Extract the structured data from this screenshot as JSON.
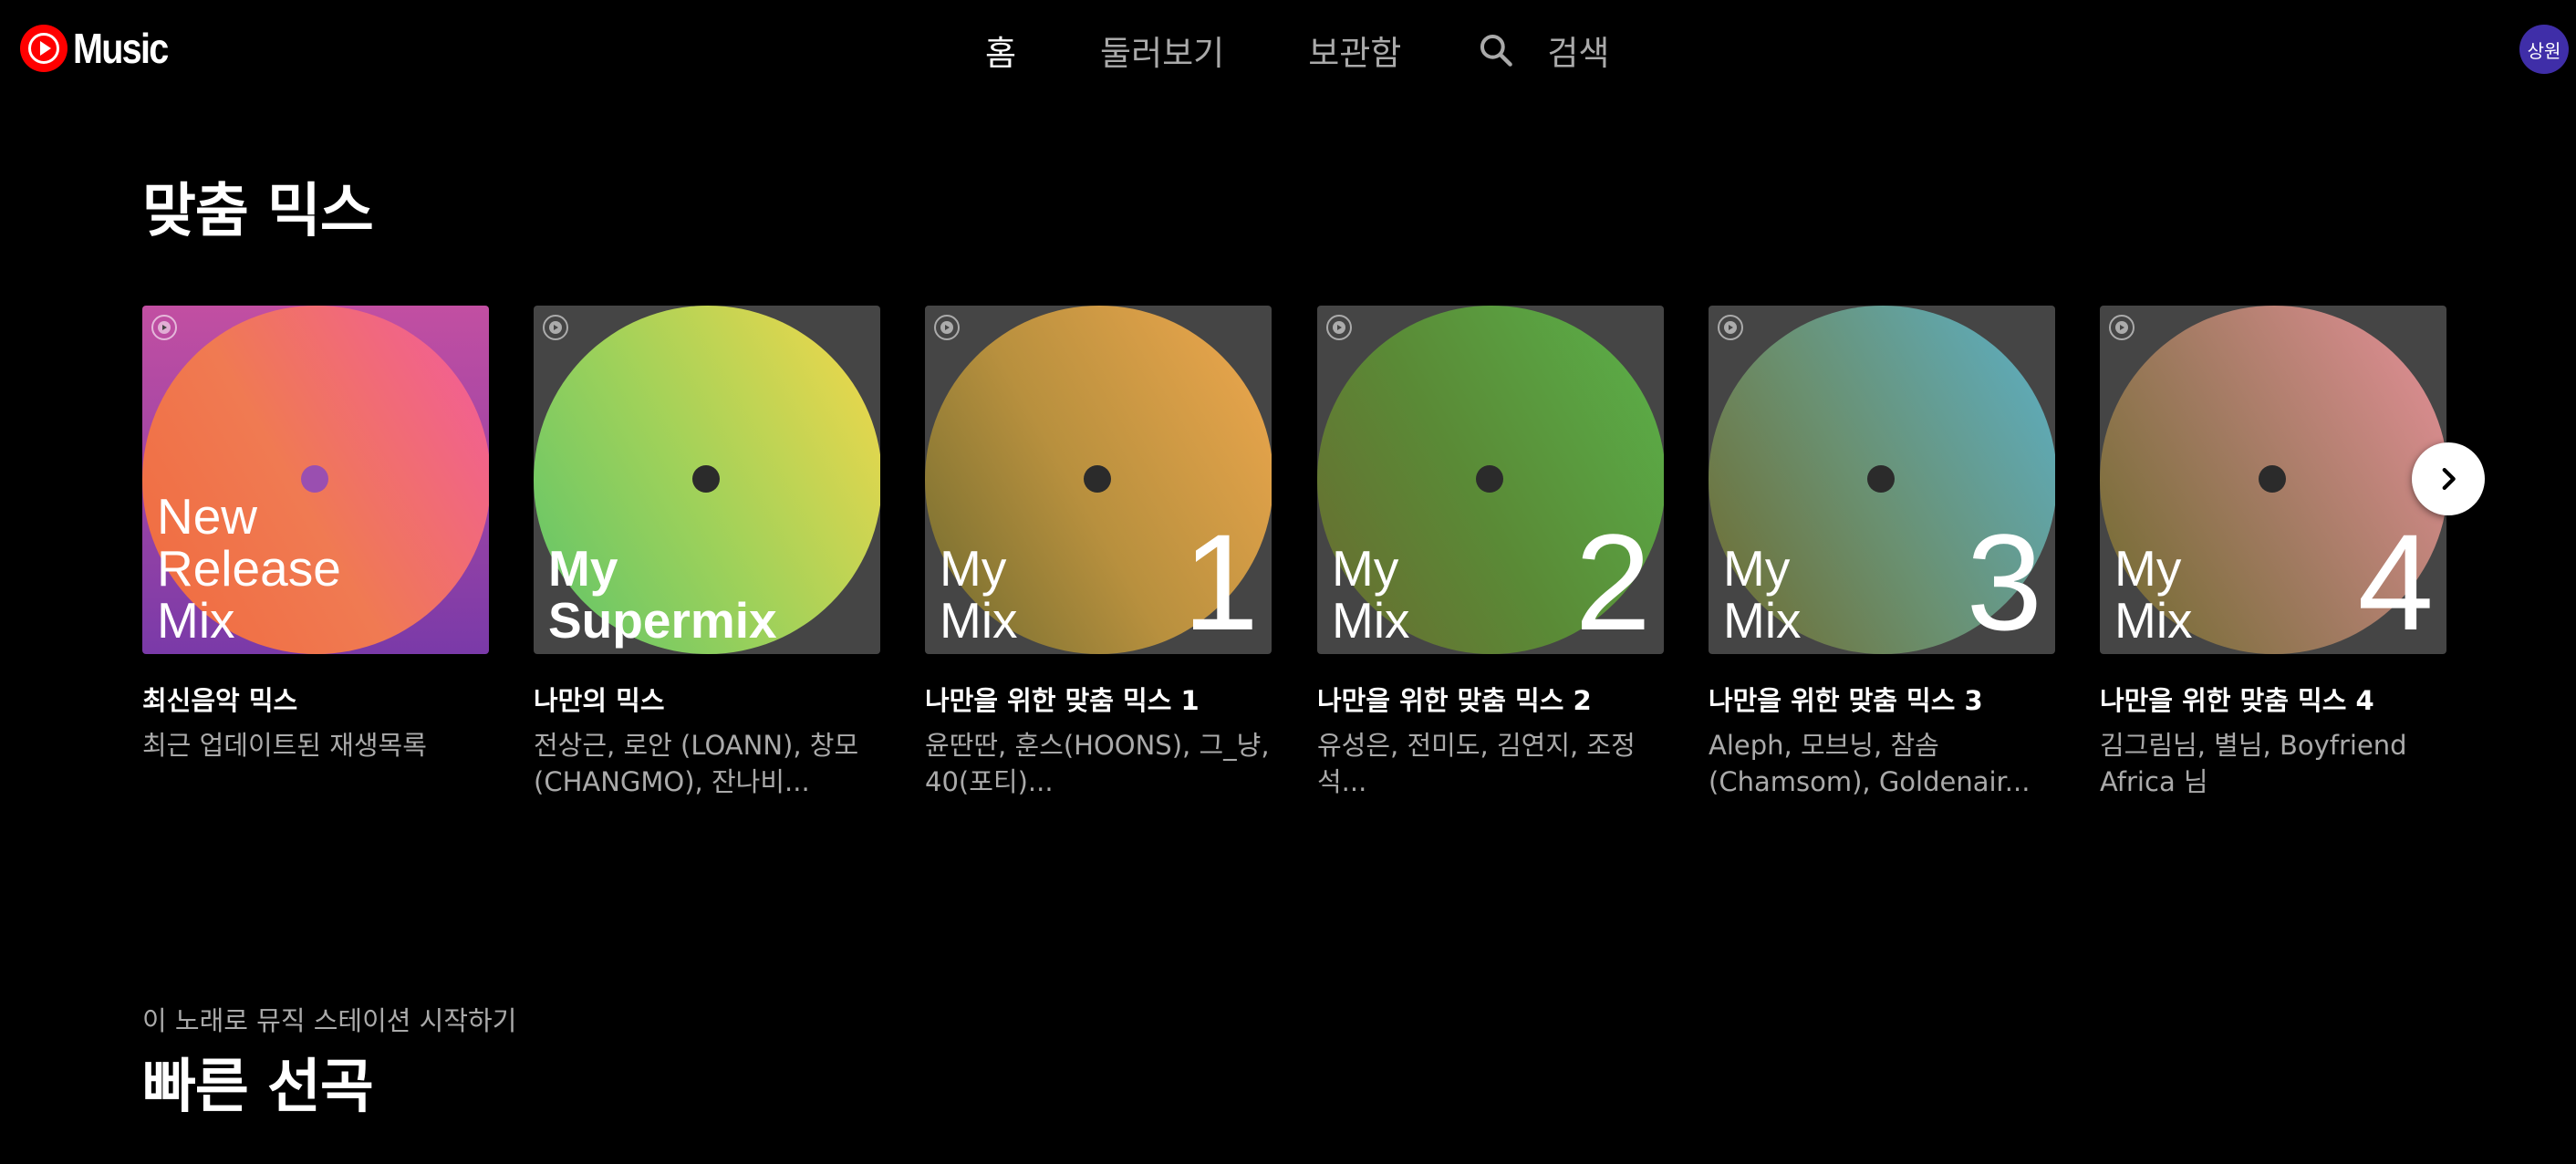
{
  "header": {
    "logo_text": "Music",
    "nav": {
      "home": "홈",
      "explore": "둘러보기",
      "library": "보관함",
      "search": "검색"
    },
    "avatar_initials": "상원"
  },
  "mix_section": {
    "title": "맞춤 믹스",
    "cards": [
      {
        "label": "New\nRelease\nMix",
        "number": "",
        "title": "최신음악 믹스",
        "subtitle": "최근 업데이트된 재생목록",
        "gradient": [
          "#f25aa0",
          "#f07a52",
          "#f06a3e"
        ]
      },
      {
        "label": "My\nSupermix",
        "number": "",
        "title": "나만의 믹스",
        "subtitle": "전상근, 로안 (LOANN), 창모 (CHANGMO), 잔나비...",
        "gradient": [
          "#f7d84a",
          "#9ed15a",
          "#5cc46a"
        ]
      },
      {
        "label": "My\nMix",
        "number": "1",
        "title": "나만을 위한 맞춤 믹스 1",
        "subtitle": "윤딴딴, 훈스(HOONS), 그_냥, 40(포티)...",
        "gradient": [
          "#f0a84e",
          "#b8903e",
          "#6e6a2e"
        ]
      },
      {
        "label": "My\nMix",
        "number": "2",
        "title": "나만을 위한 맞춤 믹스 2",
        "subtitle": "유성은, 전미도, 김연지, 조정석...",
        "gradient": [
          "#5bb24a",
          "#5a8a36",
          "#6a6a30"
        ]
      },
      {
        "label": "My\nMix",
        "number": "3",
        "title": "나만을 위한 맞춤 믹스 3",
        "subtitle": "Aleph, 모브닝, 참솜 (Chamsom), Goldenair...",
        "gradient": [
          "#5cb0c8",
          "#6a9070",
          "#6f6a2c"
        ]
      },
      {
        "label": "My\nMix",
        "number": "4",
        "title": "나만을 위한 맞춤 믹스 4",
        "subtitle": "김그림님, 별님, Boyfriend Africa 님",
        "gradient": [
          "#e6909a",
          "#a07a60",
          "#6e6a2c"
        ]
      }
    ]
  },
  "quick_section": {
    "kicker": "이 노래로 뮤직 스테이션 시작하기",
    "title": "빠른 선곡"
  },
  "icons": {
    "logo": "youtube-music-logo-icon",
    "search": "search-icon",
    "next": "chevron-right-icon",
    "badge": "play-badge-icon"
  },
  "colors": {
    "background": "#000000",
    "accent_red": "#ff0000",
    "avatar": "#3f2ea8",
    "secondary_text": "#aaaaaa"
  }
}
